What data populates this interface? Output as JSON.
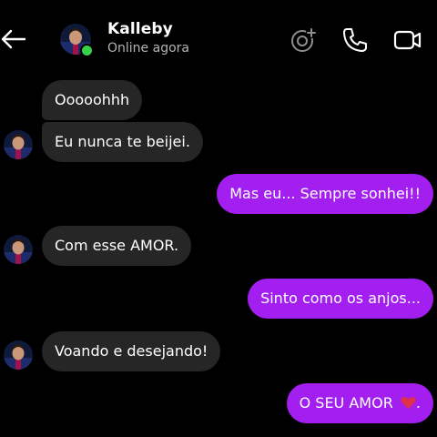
{
  "header": {
    "contact_name": "Kalleby",
    "status": "Online agora",
    "back_icon": "arrow-left-icon",
    "effects_icon": "sticker-effects-icon",
    "call_icon": "phone-icon",
    "video_icon": "video-camera-icon",
    "online_color": "#38d24a"
  },
  "messages": [
    {
      "direction": "incoming",
      "text": "Ooooohhh"
    },
    {
      "direction": "incoming",
      "text": "Eu nunca te beijei."
    },
    {
      "direction": "outgoing",
      "text": "Mas eu... Sempre sonhei!!"
    },
    {
      "direction": "incoming",
      "text": "Com esse AMOR."
    },
    {
      "direction": "outgoing",
      "text": "Sinto como os anjos..."
    },
    {
      "direction": "incoming",
      "text": "Voando e desejando!"
    },
    {
      "direction": "outgoing",
      "text": "O SEU AMOR",
      "suffix": ".",
      "emoji": "heart-icon"
    }
  ],
  "colors": {
    "background": "#000000",
    "incoming_bubble": "#262626",
    "outgoing_bubble": "#a21ff0",
    "heart": "#e0314b"
  }
}
